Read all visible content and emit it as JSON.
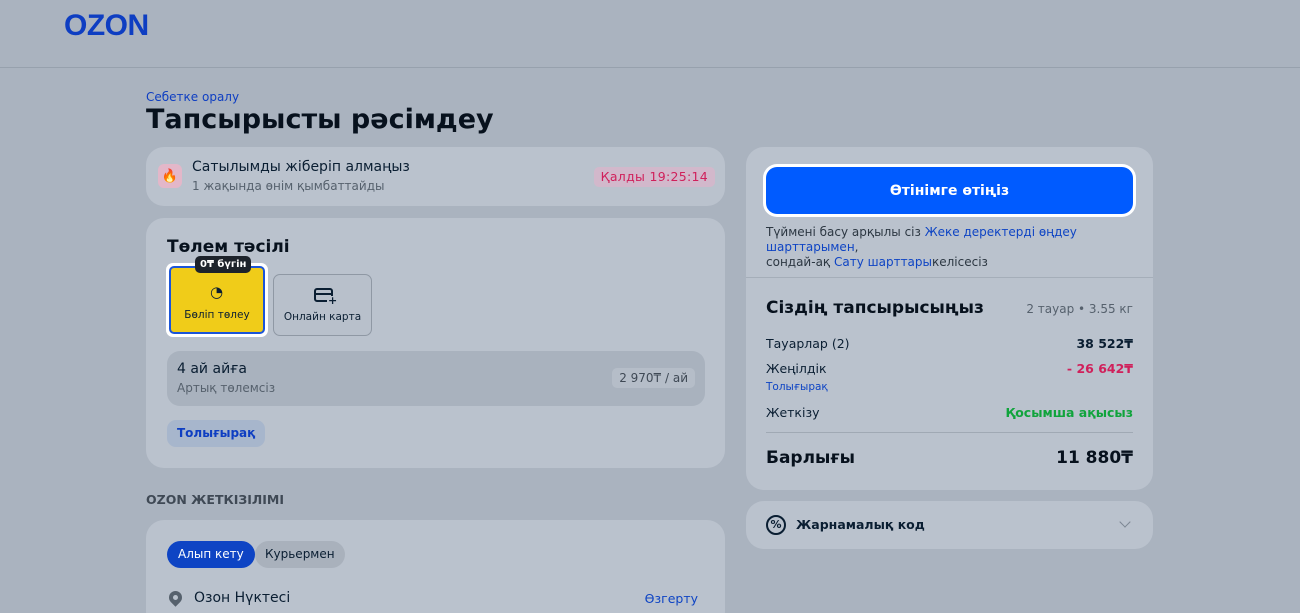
{
  "header": {
    "logo": "OZON"
  },
  "back_link": "Себетке оралу",
  "page_title": "Тапсырысты рәсімдеу",
  "promo_timer": {
    "title": "Сатылымды жіберіп алмаңыз",
    "subtitle": "1 жақында өнім қымбаттайды",
    "badge": "Қалды 19:25:14"
  },
  "payment": {
    "title": "Төлем тәсілі",
    "options": [
      {
        "label": "Бөліп төлеу",
        "badge": "0₸ бүгін",
        "selected": true
      },
      {
        "label": "Онлайн карта",
        "selected": false
      }
    ],
    "installment": {
      "title": "4 ай айға",
      "subtitle": "Артық төлемсіз",
      "price": "2 970₸ / ай"
    },
    "more_label": "Толығырақ"
  },
  "delivery": {
    "heading": "OZON ЖЕТКІЗІЛІМІ",
    "tabs": [
      "Алып кету",
      "Курьермен"
    ],
    "point_label": "Озон Нүктесі",
    "change_label": "Өзгерту"
  },
  "summary": {
    "checkout_label": "Өтінімге өтіңіз",
    "terms_prefix": "Түймені басу арқылы сіз ",
    "terms_link1": "Жеке деректерді өңдеу шарттарымен",
    "terms_mid": ",",
    "terms_line2": "сондай-ақ ",
    "terms_link2": "Сату шарттары",
    "terms_suffix": "келісесіз",
    "title": "Сіздің тапсырысыңыз",
    "meta": "2 тауар • 3.55 кг",
    "rows": [
      {
        "label": "Тауарлар (2)",
        "value": "38 522₸"
      },
      {
        "label": "Жеңілдік",
        "value": "- 26 642₸"
      },
      {
        "label": "Жеткізу",
        "value": "Қосымша ақысыз"
      }
    ],
    "discount_more": "Толығырақ",
    "total_label": "Барлығы",
    "total_value": "11 880₸"
  },
  "promo_code": {
    "label": "Жарнамалық код"
  }
}
